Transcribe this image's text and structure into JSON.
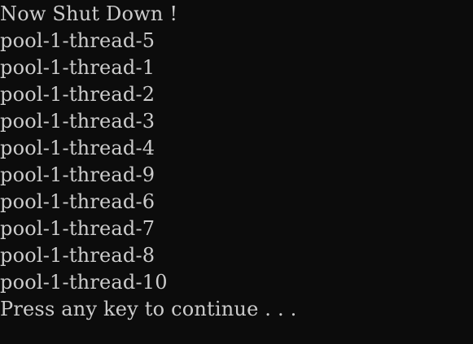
{
  "console": {
    "background": "#0c0c0c",
    "text_color": "#cccccc",
    "lines": [
      "Now Shut Down !",
      "pool-1-thread-5",
      "pool-1-thread-1",
      "pool-1-thread-2",
      "pool-1-thread-3",
      "pool-1-thread-4",
      "pool-1-thread-9",
      "pool-1-thread-6",
      "pool-1-thread-7",
      "pool-1-thread-8",
      "pool-1-thread-10",
      "Press any key to continue . . ."
    ]
  }
}
